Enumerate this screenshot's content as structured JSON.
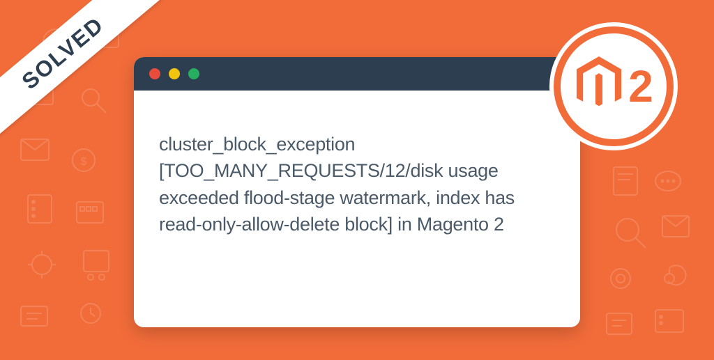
{
  "ribbon": {
    "label": "SOLVED"
  },
  "window": {
    "error_message": "cluster_block_exception [TOO_MANY_REQUESTS/12/disk usage exceeded flood-stage watermark, index has read-only-allow-delete block] in Magento 2"
  },
  "badge": {
    "version": "2"
  },
  "colors": {
    "bg": "#f26c3a",
    "titlebar": "#2c3e50",
    "text": "#4a5a68"
  }
}
